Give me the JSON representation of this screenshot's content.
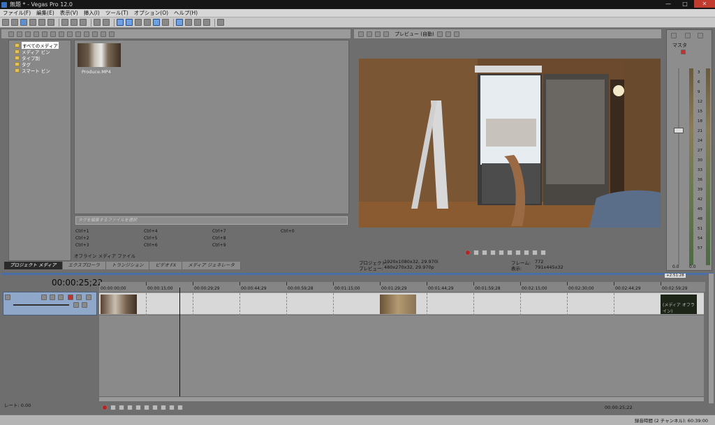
{
  "window": {
    "title": "無題 * - Vegas Pro 12.0"
  },
  "menu": [
    "ファイル(F)",
    "編集(E)",
    "表示(V)",
    "挿入(I)",
    "ツール(T)",
    "オプション(O)",
    "ヘルプ(H)"
  ],
  "explorer": {
    "tree": [
      "すべてのメディア",
      "メディア ビン",
      "タイプ別",
      "タグ",
      "スマート ビン"
    ],
    "media": [
      {
        "name": "Produce.MP4"
      }
    ],
    "search_placeholder": "タグを編集するファイルを選択",
    "shortcuts": [
      "Ctrl+1",
      "Ctrl+4",
      "Ctrl+7",
      "Ctrl+0",
      "Ctrl+2",
      "Ctrl+5",
      "Ctrl+8",
      "Ctrl+3",
      "Ctrl+6",
      "Ctrl+9"
    ],
    "offline_label": "オフライン メディア ファイル",
    "tabs": [
      "プロジェクト メディア",
      "エクスプローラ",
      "トランジション",
      "ビデオ FX",
      "メディア ジェネレータ"
    ]
  },
  "preview": {
    "mode_label": "プレビュー (自動)",
    "project_label": "プロジェクト:",
    "project_value": "1920x1080x32, 29.970i",
    "preview_label": "プレビュー:",
    "preview_value": "480x270x32, 29.970p",
    "frame_label": "フレーム:",
    "frame_value": "772",
    "display_label": "表示:",
    "display_value": "791x445x32"
  },
  "master": {
    "title": "マスタ",
    "ticks": [
      "3",
      "6",
      "9",
      "12",
      "15",
      "18",
      "21",
      "24",
      "27",
      "30",
      "33",
      "36",
      "39",
      "42",
      "45",
      "48",
      "51",
      "54",
      "57"
    ],
    "left_value": "0.0",
    "right_value": "0.0"
  },
  "timeline": {
    "timecode": "00:00:25;22",
    "end_marker": "+2:51:28",
    "ruler": [
      "00:00:00;00",
      "00:00:15;00",
      "00:00:29;29",
      "00:00:44;29",
      "00:00:59;28",
      "00:01:15;00",
      "00:01:29;29",
      "00:01:44;29",
      "00:01:59;28",
      "00:02:15;00",
      "00:02:30;00",
      "00:02:44;29",
      "00:02:59;29"
    ],
    "offline_clip": "(メディア オフライン)",
    "rate": "レート: 0.00",
    "cursor_time": "00:00:25;22",
    "status": "録音時間 (2 チャンネル): 60:39:00"
  }
}
